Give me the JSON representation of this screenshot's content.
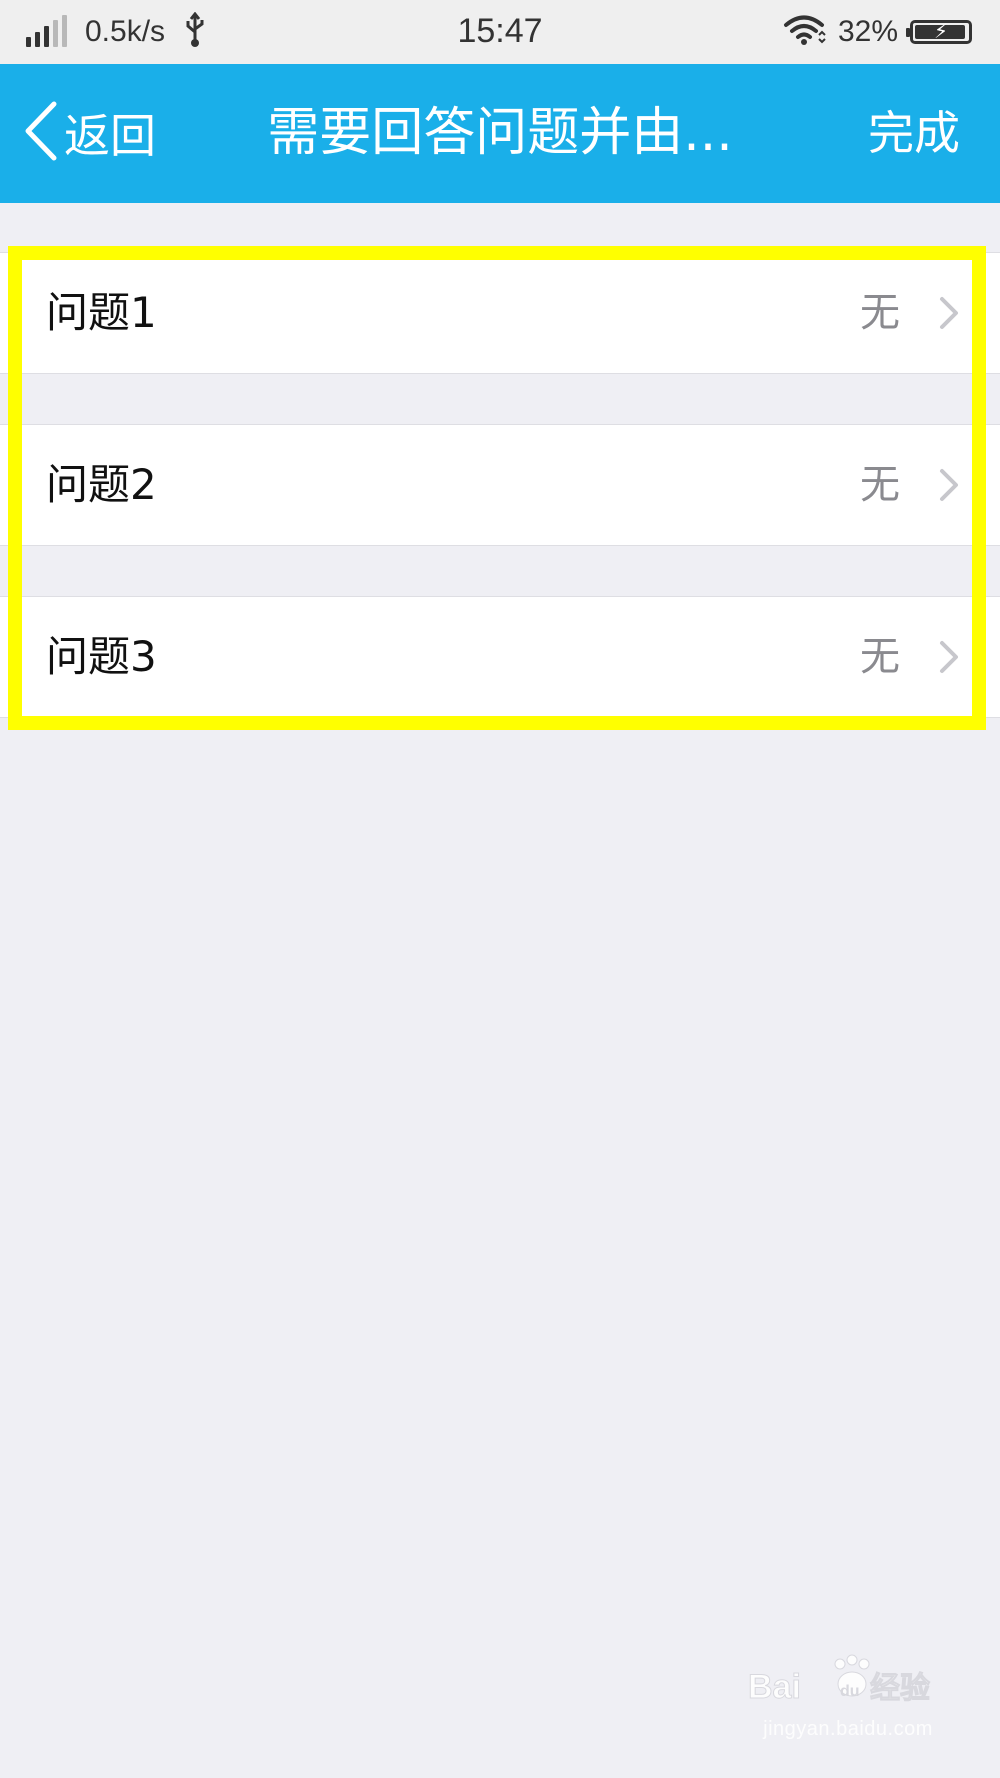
{
  "status_bar": {
    "network_speed": "0.5k/s",
    "time": "15:47",
    "battery_percent": "32%",
    "icons": [
      "signal-icon",
      "usb-icon",
      "wifi-icon",
      "battery-charging-icon"
    ]
  },
  "nav": {
    "back_label": "返回",
    "title": "需要回答问题并由...",
    "done_label": "完成",
    "background_color": "#1aafe9"
  },
  "questions": [
    {
      "label": "问题1",
      "value": "无"
    },
    {
      "label": "问题2",
      "value": "无"
    },
    {
      "label": "问题3",
      "value": "无"
    }
  ],
  "highlight_color": "#ffff00",
  "watermark": {
    "logo_text": "Baidu经验",
    "url": "jingyan.baidu.com"
  }
}
